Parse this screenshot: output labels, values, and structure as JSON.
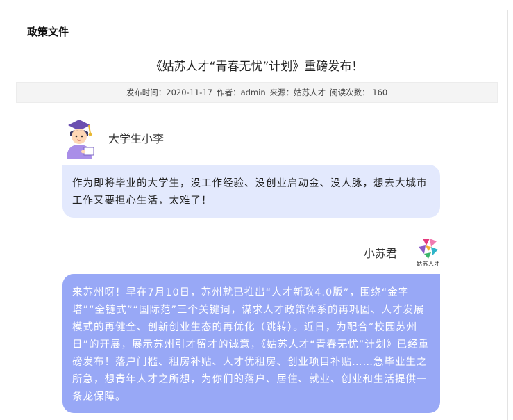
{
  "section": {
    "title": "政策文件"
  },
  "article": {
    "title": "《姑苏人才“青春无忧”计划》重磅发布！",
    "meta": {
      "publish_time": "发布时间：2020-11-17",
      "author": "作者：admin",
      "source": "来源：姑苏人才",
      "read_count": "阅读次数：  160"
    }
  },
  "chat": {
    "persona1": {
      "name": "大学生小李",
      "avatar_icon": "graduate-student-icon"
    },
    "message1": "作为即将毕业的大学生，没工作经验、没创业启动金、没人脉，想去大城市工作又要担心生活，太难了！",
    "persona2": {
      "name": "小苏君",
      "logo_text": "姑苏人才",
      "logo_icon": "gusu-talent-logo-icon"
    },
    "message2": "来苏州呀！早在7月10日，苏州就已推出“人才新政4.0版”，围绕“金字塔”“全链式”“国际范”三个关键词，谋求人才政策体系的再巩固、人才发展模式的再健全、创新创业生态的再优化（跳转）。近日，为配合“校园苏州日”的开展，展示苏州引才留才的诚意，《姑苏人才“青春无忧”计划》已经重磅发布！落户门槛、租房补贴、人才优租房、创业项目补贴……急毕业生之所急，想青年人才之所想，为你们的落户、居住、就业、创业和生活提供一条龙保障。"
  },
  "colors": {
    "bubble1": "#e3e9fd",
    "bubble2": "#98a8f6"
  }
}
